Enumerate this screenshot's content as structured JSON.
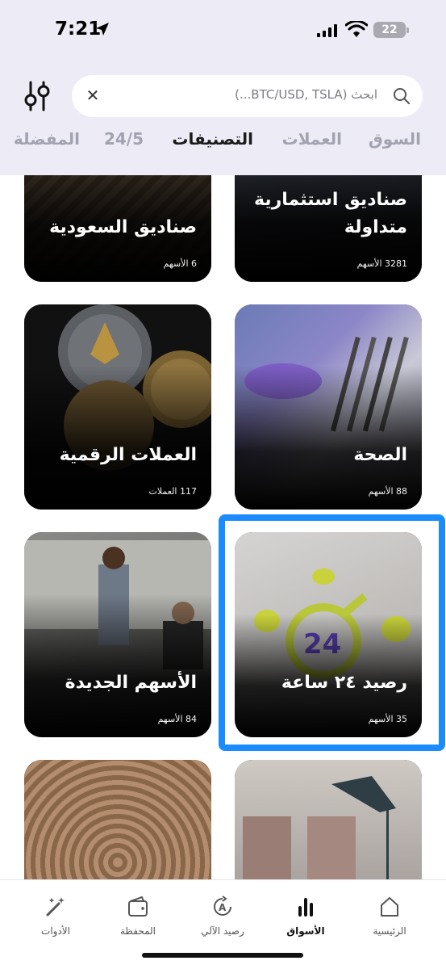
{
  "status_bar": {
    "time": "7:21",
    "battery": "22"
  },
  "search": {
    "placeholder": "ابحث (BTC/USD, TSLA...)"
  },
  "tabs": [
    {
      "label": "السوق"
    },
    {
      "label": "العملات"
    },
    {
      "label": "التصنيفات"
    },
    {
      "label": "24/5"
    },
    {
      "label": "المفضلة"
    }
  ],
  "cards": [
    {
      "title": "صناديق استثمارية متداولة",
      "count": "3281 الأسهم"
    },
    {
      "title": "صناديق السعودية",
      "count": "6 الأسهم"
    },
    {
      "title": "الصحة",
      "count": "88 الأسهم"
    },
    {
      "title": "العملات الرقمية",
      "count": "117 العملات"
    },
    {
      "title": "رصيد ٢٤ ساعة",
      "count": "35 الأسهم"
    },
    {
      "title": "الأسهم الجديدة",
      "count": "84 الأسهم"
    }
  ],
  "bottom_nav": [
    {
      "label": "الرئيسية"
    },
    {
      "label": "الأسواق"
    },
    {
      "label": "رصيد الآلي"
    },
    {
      "label": "المحفظة"
    },
    {
      "label": "الأدوات"
    }
  ],
  "colors": {
    "header_bg": "#ecebf6",
    "highlight": "#1a8cff",
    "tab_inactive": "#a3a2b0"
  }
}
